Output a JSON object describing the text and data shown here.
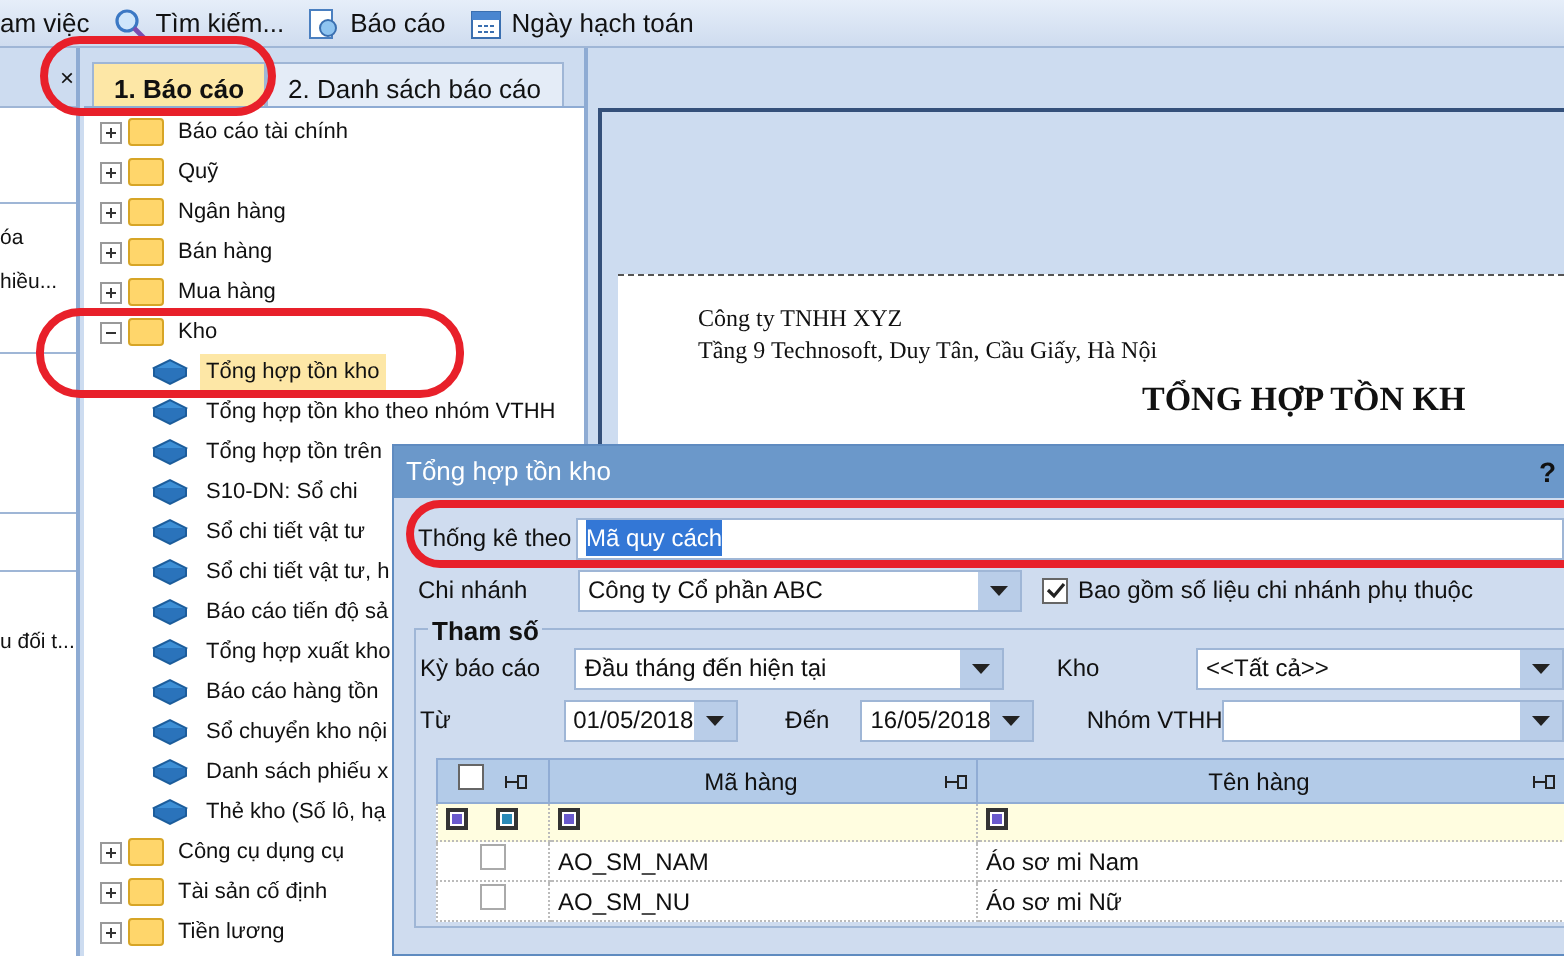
{
  "toolbar": {
    "items": [
      {
        "kind": "text",
        "label": "am việc"
      },
      {
        "kind": "search",
        "label": "Tìm kiếm..."
      },
      {
        "kind": "report",
        "label": "Báo cáo"
      },
      {
        "kind": "calendar",
        "label": "Ngày hạch toán"
      }
    ]
  },
  "side_panel": {
    "close": "×",
    "items": [
      "óa",
      "hiều...",
      "u đối t..."
    ]
  },
  "tabs": [
    {
      "label": "1. Báo cáo",
      "selected": true
    },
    {
      "label": "2. Danh sách báo cáo",
      "selected": false
    }
  ],
  "tree": [
    {
      "label": "Báo cáo tài chính",
      "expanded": false
    },
    {
      "label": "Quỹ",
      "expanded": false
    },
    {
      "label": "Ngân hàng",
      "expanded": false
    },
    {
      "label": "Bán hàng",
      "expanded": false
    },
    {
      "label": "Mua hàng",
      "expanded": false
    },
    {
      "label": "Kho",
      "expanded": true,
      "children": [
        {
          "label": "Tổng hợp tồn kho",
          "selected": true
        },
        {
          "label": "Tổng hợp tồn kho theo nhóm VTHH",
          "selected": false
        },
        {
          "label": "Tổng hợp tồn trên",
          "selected": false
        },
        {
          "label": "S10-DN: Sổ chi",
          "selected": false
        },
        {
          "label": "Sổ chi tiết vật tư",
          "selected": false
        },
        {
          "label": "Sổ chi tiết vật tư, h",
          "selected": false
        },
        {
          "label": "Báo cáo tiến độ sả",
          "selected": false
        },
        {
          "label": "Tổng hợp xuất kho",
          "selected": false
        },
        {
          "label": "Báo cáo hàng tồn",
          "selected": false
        },
        {
          "label": "Sổ chuyển kho nội",
          "selected": false
        },
        {
          "label": "Danh sách phiếu x",
          "selected": false
        },
        {
          "label": "Thẻ kho (Số lô, hạ",
          "selected": false
        }
      ]
    },
    {
      "label": "Công cụ dụng cụ",
      "expanded": false
    },
    {
      "label": "Tài sản cố định",
      "expanded": false
    },
    {
      "label": "Tiền lương",
      "expanded": false
    }
  ],
  "report": {
    "company": "Công ty TNHH XYZ",
    "address": "Tầng 9 Technosoft, Duy Tân, Cầu Giấy, Hà Nội",
    "title": "TỔNG HỢP TỒN KH"
  },
  "dialog": {
    "title": "Tổng hợp tồn kho",
    "help": "?",
    "stat_by": {
      "label": "Thống kê theo",
      "value": "Mã quy cách",
      "text_selected": true
    },
    "branch": {
      "label": "Chi nhánh",
      "value": "Công ty Cổ phần ABC"
    },
    "include_dependent": {
      "label": "Bao gồm số liệu chi nhánh phụ thuộc",
      "checked": true
    },
    "params": {
      "legend": "Tham số",
      "period": {
        "label": "Kỳ báo cáo",
        "value": "Đầu tháng đến hiện tại"
      },
      "warehouse": {
        "label": "Kho",
        "value": "<<Tất cả>>"
      },
      "from": {
        "label": "Từ",
        "value": "01/05/2018"
      },
      "to": {
        "label": "Đến",
        "value": "16/05/2018"
      },
      "group": {
        "label": "Nhóm VTHH"
      }
    },
    "grid": {
      "select_all_checked": false,
      "columns": [
        "Mã hàng",
        "Tên hàng"
      ],
      "rows": [
        {
          "checked": false,
          "code": "AO_SM_NAM",
          "name": "Áo sơ mi Nam"
        },
        {
          "checked": false,
          "code": "AO_SM_NU",
          "name": "Áo sơ mi Nữ"
        }
      ]
    }
  }
}
